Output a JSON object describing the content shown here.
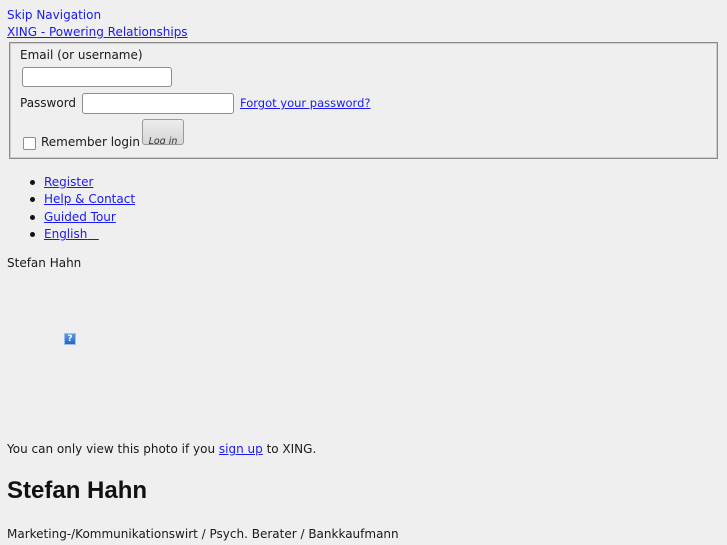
{
  "header": {
    "skip_navigation": "Skip Navigation",
    "home_link": "XING - Powering Relationships"
  },
  "login": {
    "email_label": "Email (or username)",
    "email_value": "",
    "password_label": "Password",
    "password_value": "",
    "forgot_password": "Forgot your password?",
    "remember_label": "Remember login",
    "remember_checked": false,
    "login_button": "Log in"
  },
  "nav": {
    "items": [
      {
        "label": "Register"
      },
      {
        "label": "Help & Contact"
      },
      {
        "label": "Guided Tour"
      },
      {
        "label": "English"
      }
    ]
  },
  "profile": {
    "name_small": "Stefan Hahn",
    "photo_icon": "missing-image-icon",
    "photo_note_prefix": "You can only view this photo if you ",
    "photo_note_link": "sign up",
    "photo_note_suffix": " to XING.",
    "name": "Stefan Hahn",
    "title": "Marketing-/Kommunikationswirt / Psych. Berater / Bankkaufmann"
  }
}
